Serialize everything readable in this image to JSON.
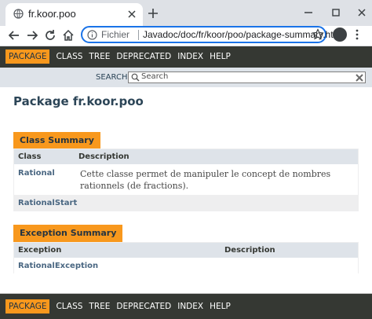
{
  "browser": {
    "tab_title": "fr.koor.poo",
    "address_scheme": "Fichier",
    "address_url": "Javadoc/doc/fr/koor/poo/package-summary.html"
  },
  "navbar": {
    "items": [
      "PACKAGE",
      "CLASS",
      "TREE",
      "DEPRECATED",
      "INDEX",
      "HELP"
    ],
    "active": "PACKAGE"
  },
  "search": {
    "label": "SEARCH:",
    "placeholder": "Search"
  },
  "page": {
    "title": "Package fr.koor.poo"
  },
  "class_summary": {
    "caption": "Class Summary",
    "headers": [
      "Class",
      "Description"
    ],
    "rows": [
      {
        "name": "Rational",
        "description": "Cette classe permet de manipuler le concept de nombres rationnels (de fractions)."
      },
      {
        "name": "RationalStart",
        "description": ""
      }
    ]
  },
  "exception_summary": {
    "caption": "Exception Summary",
    "headers": [
      "Exception",
      "Description"
    ],
    "rows": [
      {
        "name": "RationalException",
        "description": ""
      }
    ]
  },
  "colors": {
    "navbar_bg": "#353833",
    "accent_orange": "#f8981d",
    "header_bg": "#dee3e9",
    "link": "#4a6782"
  }
}
